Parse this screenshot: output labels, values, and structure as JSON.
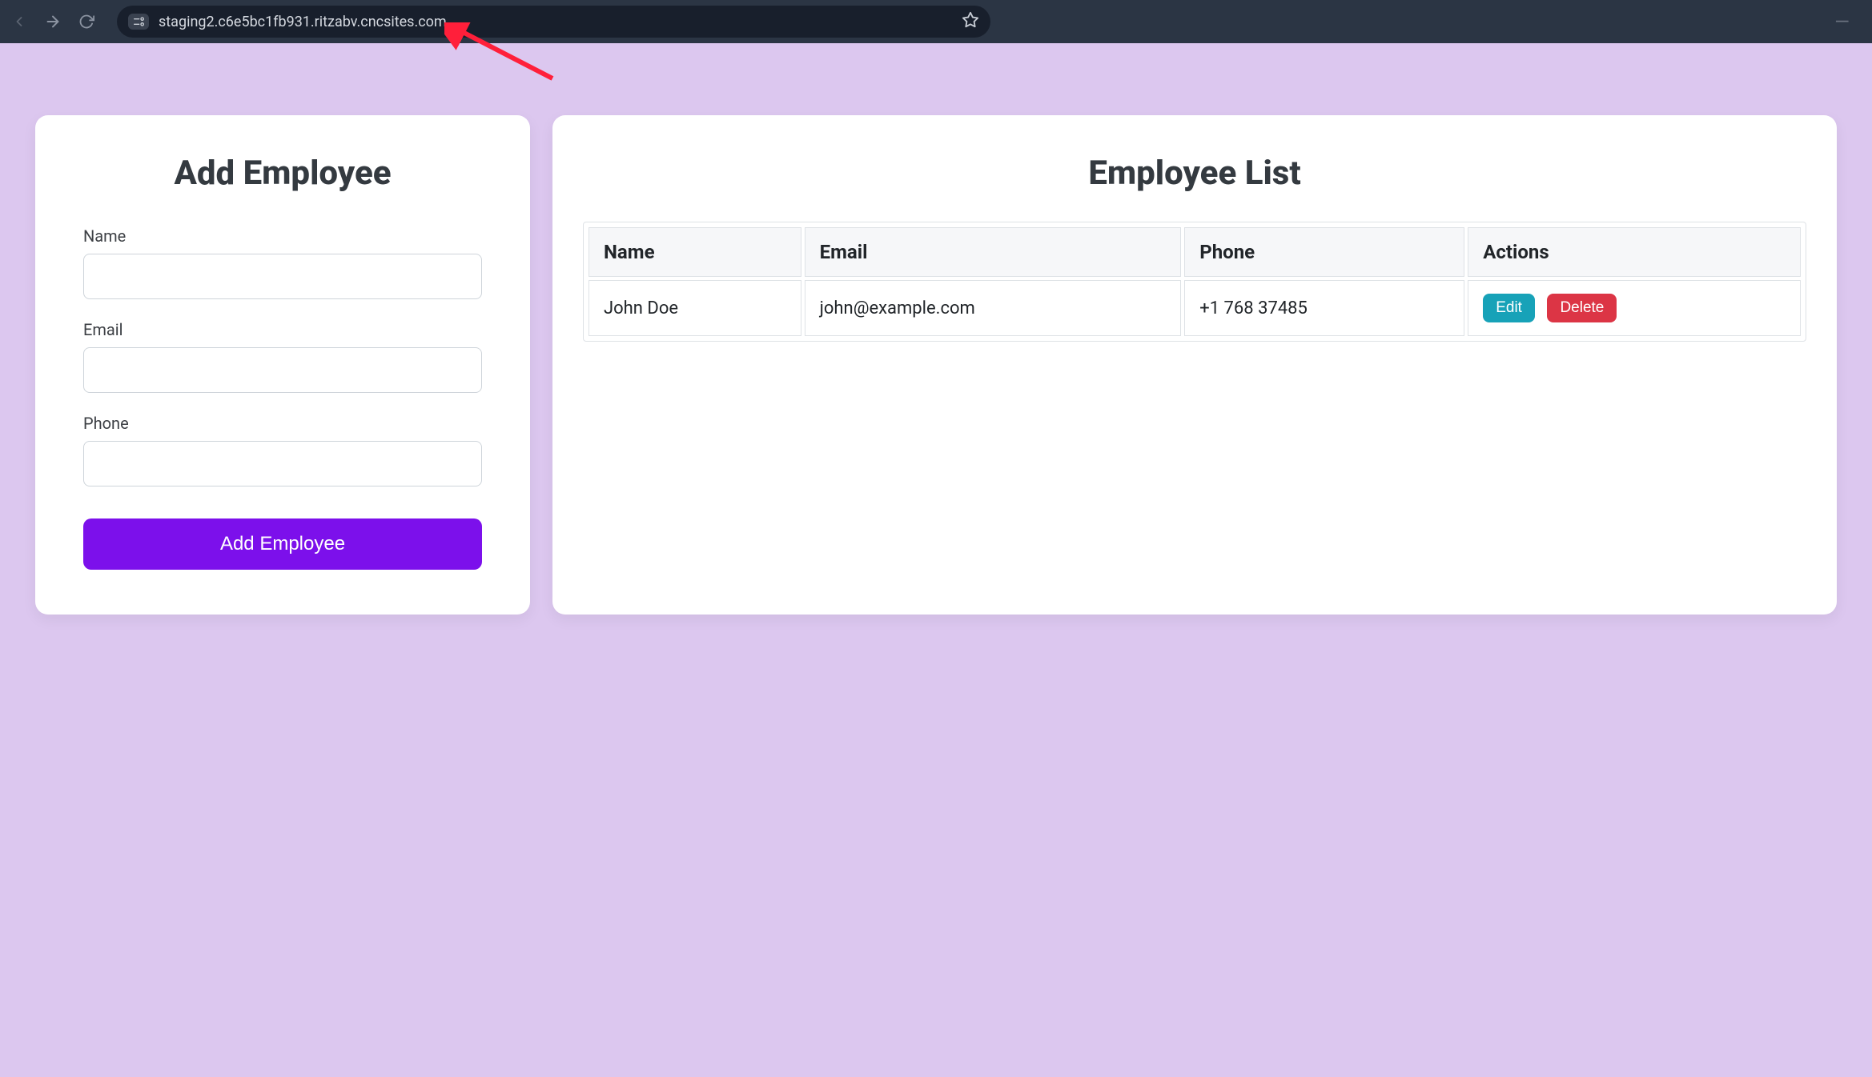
{
  "browser": {
    "url": "staging2.c6e5bc1fb931.ritzabv.cncsites.com"
  },
  "form": {
    "title": "Add Employee",
    "name_label": "Name",
    "name_value": "",
    "email_label": "Email",
    "email_value": "",
    "phone_label": "Phone",
    "phone_value": "",
    "submit_label": "Add Employee"
  },
  "list": {
    "title": "Employee List",
    "columns": {
      "name": "Name",
      "email": "Email",
      "phone": "Phone",
      "actions": "Actions"
    },
    "rows": [
      {
        "name": "John Doe",
        "email": "john@example.com",
        "phone": "+1 768 37485"
      }
    ],
    "edit_label": "Edit",
    "delete_label": "Delete"
  }
}
